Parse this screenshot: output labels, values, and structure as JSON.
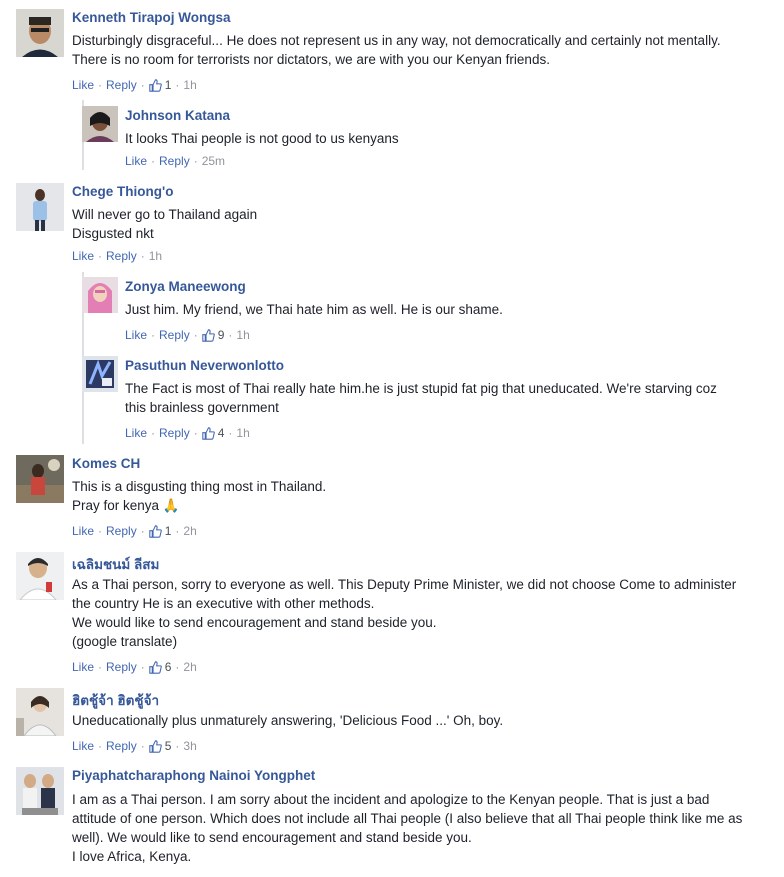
{
  "labels": {
    "like": "Like",
    "reply": "Reply",
    "dot": "·"
  },
  "comments": [
    {
      "author": "Kenneth Tirapoj Wongsa",
      "lines": [
        "Disturbingly disgraceful... He does not represent us in any way, not democratically and certainly not mentally.",
        "There is no room for terrorists nor dictators, we are with you our Kenyan friends."
      ],
      "likes": "1",
      "time": "1h"
    },
    {
      "author": "Johnson Katana",
      "lines": [
        "It looks Thai people is not good to us kenyans"
      ],
      "likes": "",
      "time": "25m"
    },
    {
      "author": "Chege Thiong'o",
      "lines": [
        "Will never go to Thailand again",
        "Disgusted nkt"
      ],
      "likes": "",
      "time": "1h"
    },
    {
      "author": "Zonya Maneewong",
      "lines": [
        "Just him. My friend, we Thai hate him as well. He is our shame."
      ],
      "likes": "9",
      "time": "1h"
    },
    {
      "author": "Pasuthun Neverwonlotto",
      "lines": [
        "The Fact is most of Thai really hate him.he is just stupid fat pig that uneducated. We're starving coz",
        "this brainless government"
      ],
      "likes": "4",
      "time": "1h"
    },
    {
      "author": "Komes CH",
      "lines": [
        "This is a disgusting thing most in Thailand.",
        "Pray for kenya 🙏"
      ],
      "likes": "1",
      "time": "2h"
    },
    {
      "author": "เฉลิมชนม์ ลีสม",
      "lines": [
        "As a Thai person, sorry to everyone as well. This Deputy Prime Minister, we did not choose Come to administer",
        "the country He is an executive with other methods.",
        "We would like to send encouragement and stand beside you.",
        "(google translate)"
      ],
      "likes": "6",
      "time": "2h"
    },
    {
      "author": "ฮิตชู้จ้า ฮิตชู้จ้า",
      "lines": [
        "Uneducationally plus unmaturely answering, 'Delicious Food ...' Oh, boy."
      ],
      "likes": "5",
      "time": "3h"
    },
    {
      "author": "Piyaphatcharaphong Nainoi Yongphet",
      "lines": [
        "I am as a Thai person. I am sorry about the incident and apologize to the Kenyan people. That is just a bad",
        "attitude of one person. Which does not include all Thai people (I also believe that all Thai people think like me as",
        "well). We would like to send encouragement and stand beside you.",
        "I love Africa, Kenya."
      ],
      "likes": "",
      "time": ""
    }
  ],
  "colors": {
    "link": "#4267b2",
    "author": "#365899",
    "meta": "#90949c",
    "text": "#1d2129",
    "divider": "#dddfe2"
  }
}
